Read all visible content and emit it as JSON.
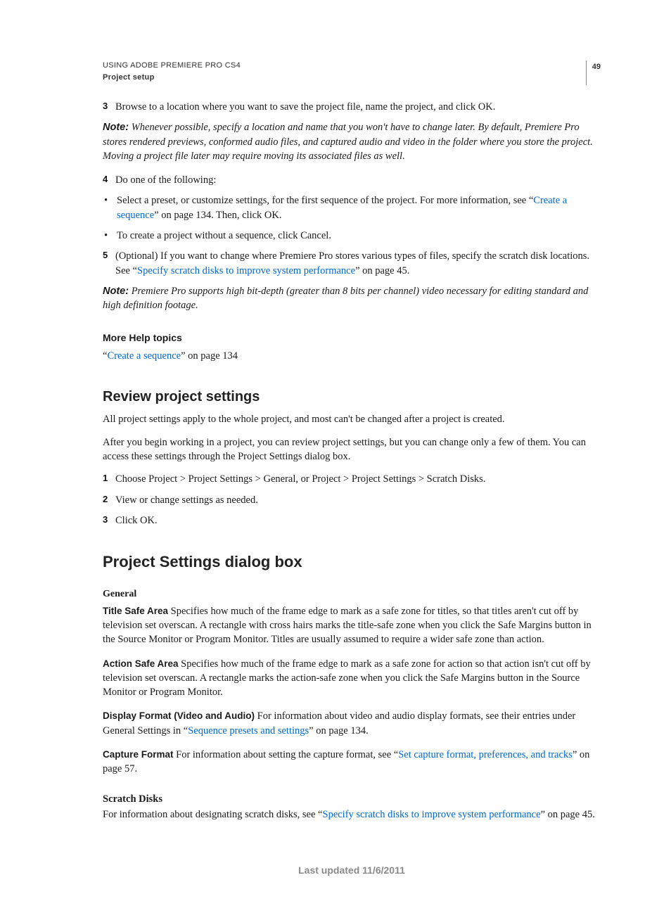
{
  "header": {
    "line1": "USING ADOBE PREMIERE PRO CS4",
    "line2": "Project setup",
    "pageNumber": "49"
  },
  "body": {
    "step3": "Browse to a location where you want to save the project file, name the project, and click OK.",
    "note1_label": "Note:",
    "note1": " Whenever possible, specify a location and name that you won't have to change later. By default, Premiere Pro stores rendered previews, conformed audio files, and captured audio and video in the folder where you store the project. Moving a project file later may require moving its associated files as well.",
    "step4": "Do one of the following:",
    "bullet1_pre": "Select a preset, or customize settings, for the first sequence of the project. For more information, see “",
    "bullet1_link": "Create a sequence",
    "bullet1_post": "” on page 134. Then, click OK.",
    "bullet2": "To create a project without a sequence, click Cancel.",
    "step5_pre": "(Optional) If you want to change where Premiere Pro stores various types of files, specify the scratch disk locations. See “",
    "step5_link": "Specify scratch disks to improve system performance",
    "step5_post": "” on page 45.",
    "note2_label": "Note:",
    "note2": " Premiere Pro supports high bit-depth (greater than 8 bits per channel) video necessary for editing standard and high definition footage.",
    "moreHelpHeading": "More Help topics",
    "moreHelp_pre": "“",
    "moreHelp_link": "Create a sequence",
    "moreHelp_post": "” on page 134",
    "reviewHeading": "Review project settings",
    "review_p1": "All project settings apply to the whole project, and most can't be changed after a project is created.",
    "review_p2": "After you begin working in a project, you can review project settings, but you can change only a few of them. You can access these settings through the Project Settings dialog box.",
    "review_step1": "Choose Project > Project Settings > General, or Project > Project Settings > Scratch Disks.",
    "review_step2": "View or change settings as needed.",
    "review_step3": "Click OK.",
    "dialogHeading": "Project Settings dialog box",
    "generalHeading": "General",
    "titleSafe_label": "Title Safe Area",
    "titleSafe_text": "  Specifies how much of the frame edge to mark as a safe zone for titles, so that titles aren't cut off by television set overscan. A rectangle with cross hairs marks the title-safe zone when you click the Safe Margins button in the Source Monitor or Program Monitor. Titles are usually assumed to require a wider safe zone than action.",
    "actionSafe_label": "Action Safe Area",
    "actionSafe_text": "  Specifies how much of the frame edge to mark as a safe zone for action so that action isn't cut off by television set overscan. A rectangle marks the action-safe zone when you click the Safe Margins button in the Source Monitor or Program Monitor.",
    "displayFormat_label": "Display Format (Video and Audio)",
    "displayFormat_pre": "  For information about video and audio display formats, see their entries under General Settings in “",
    "displayFormat_link": "Sequence presets and settings",
    "displayFormat_post": "” on page 134.",
    "captureFormat_label": "Capture Format",
    "captureFormat_pre": "  For information about setting the capture format, see “",
    "captureFormat_link": "Set capture format, preferences, and tracks",
    "captureFormat_post": "” on page 57.",
    "scratchHeading": "Scratch Disks",
    "scratch_pre": "For information about designating scratch disks, see “",
    "scratch_link": "Specify scratch disks to improve system performance",
    "scratch_post": "” on page 45."
  },
  "footer": {
    "lastUpdated": "Last updated 11/6/2011"
  },
  "nums": {
    "n3": "3",
    "n4": "4",
    "n5": "5",
    "n1": "1",
    "n2": "2",
    "n3b": "3"
  },
  "bullet": "•"
}
